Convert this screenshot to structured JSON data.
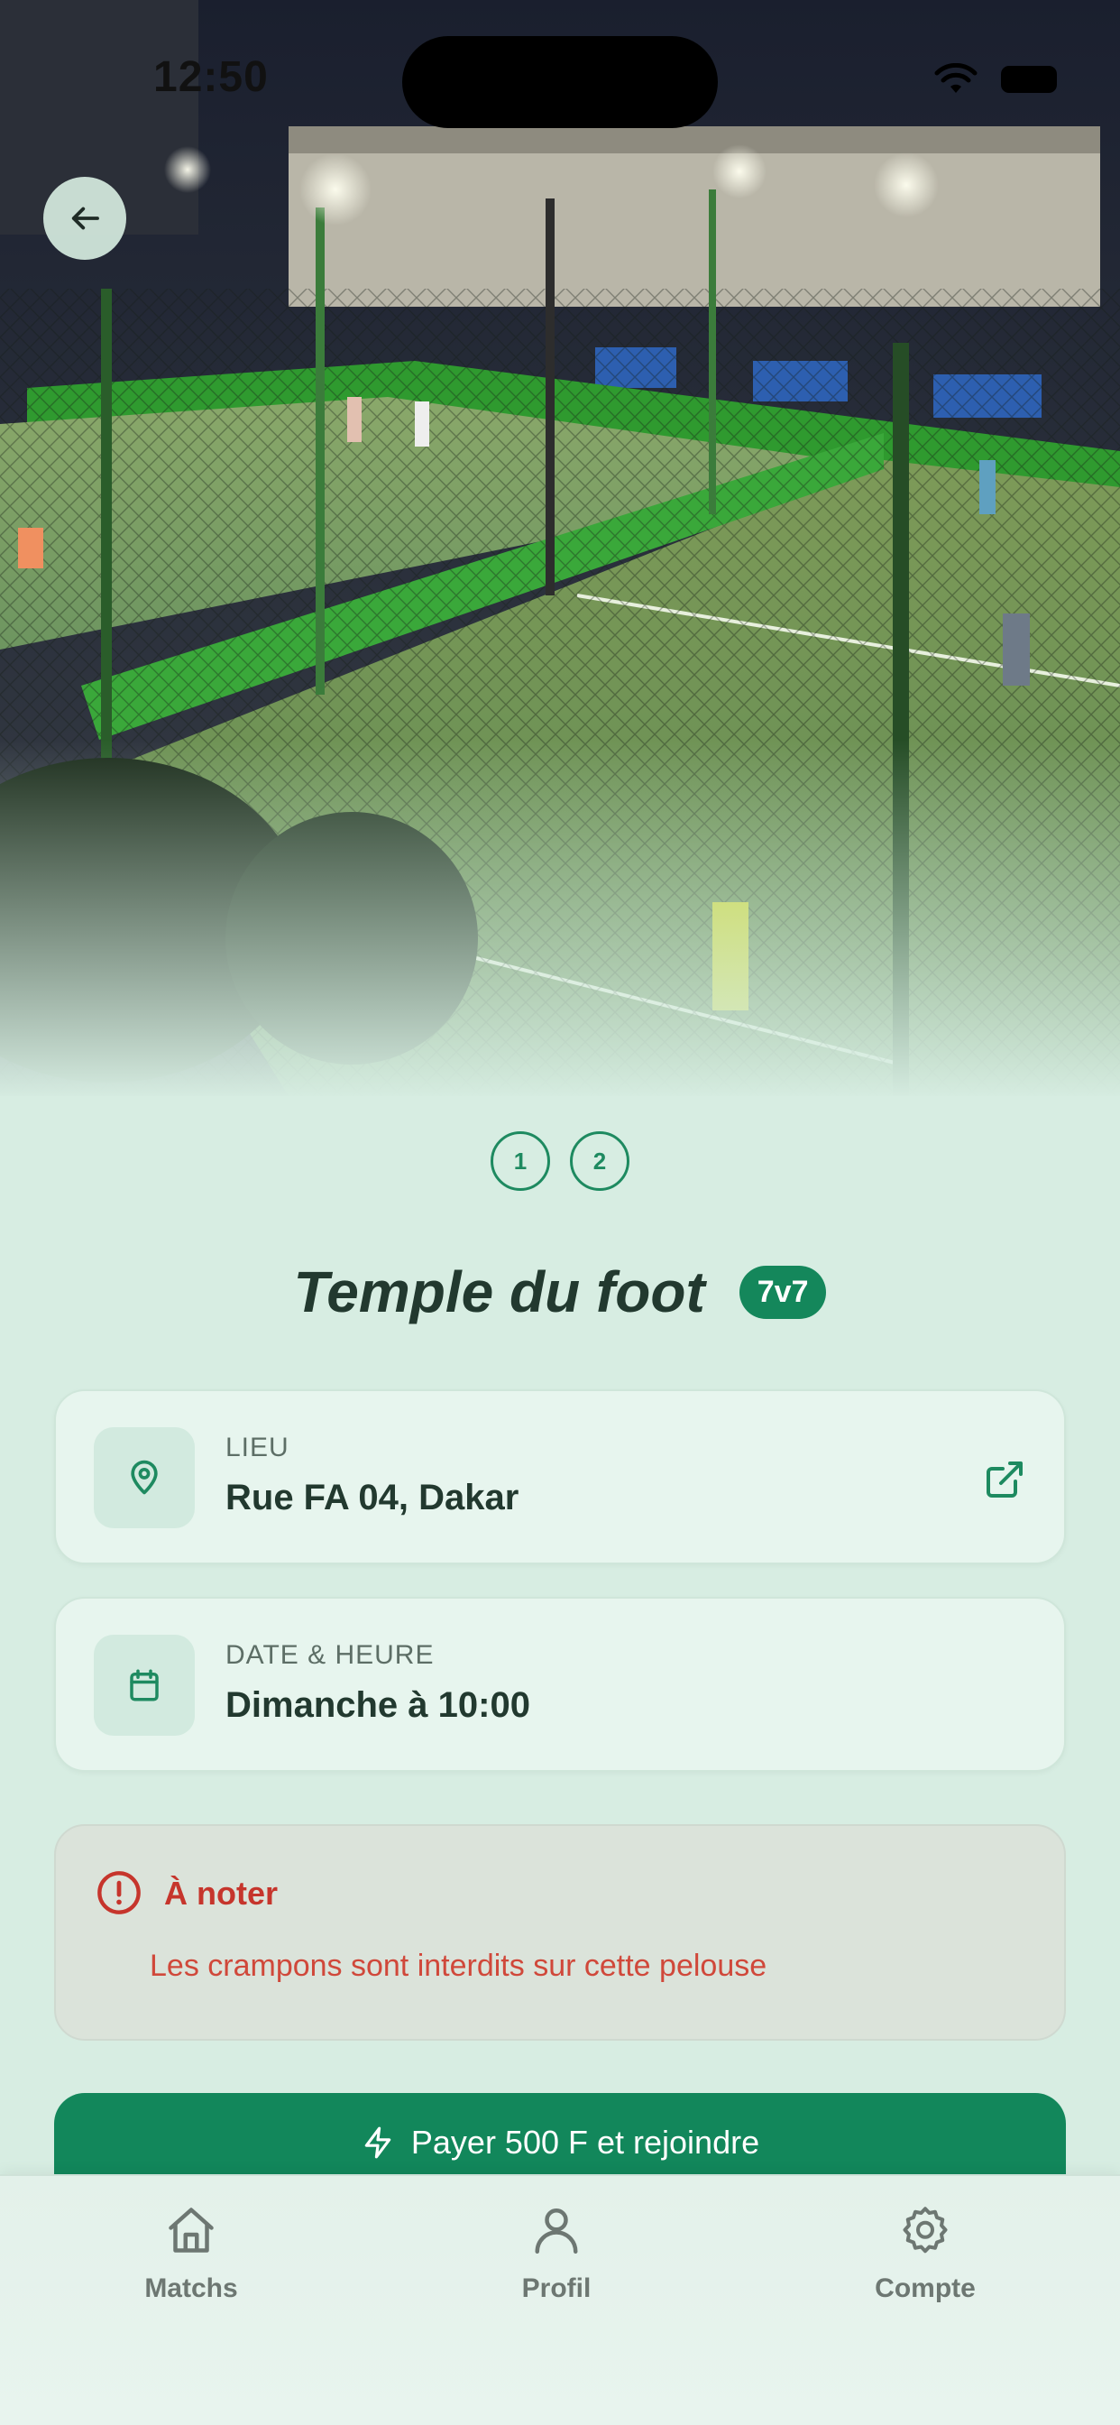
{
  "status_bar": {
    "time": "12:50"
  },
  "gallery": {
    "pages": [
      "1",
      "2"
    ]
  },
  "venue": {
    "name": "Temple du foot",
    "format_badge": "7v7"
  },
  "location_card": {
    "label": "LIEU",
    "value": "Rue FA 04, Dakar",
    "icon": "map-pin-icon",
    "action_icon": "external-link-icon"
  },
  "datetime_card": {
    "label": "DATE & HEURE",
    "value": "Dimanche à 10:00",
    "icon": "calendar-icon"
  },
  "note": {
    "title": "À noter",
    "text": "Les crampons sont interdits sur cette pelouse",
    "icon": "alert-circle-icon"
  },
  "cta": {
    "label": "Payer 500 F et rejoindre",
    "icon": "lightning-icon"
  },
  "tabbar": {
    "items": [
      {
        "label": "Matchs",
        "icon": "home-icon"
      },
      {
        "label": "Profil",
        "icon": "user-icon"
      },
      {
        "label": "Compte",
        "icon": "gear-icon"
      }
    ]
  },
  "colors": {
    "accent": "#12875b",
    "background": "#d7ede2",
    "warning": "#c6352c"
  }
}
